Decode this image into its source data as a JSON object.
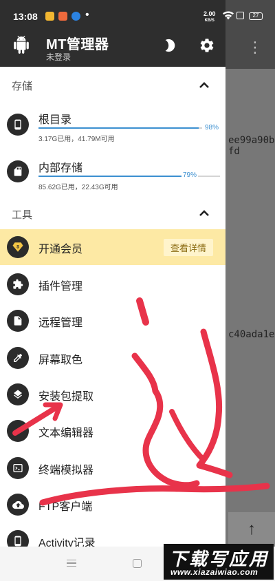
{
  "status_bar": {
    "time": "13:08",
    "dot": "•",
    "net_speed_value": "2.00",
    "net_speed_unit": "KB/S",
    "battery": "27"
  },
  "background": {
    "text_line_1": "ee99a90b",
    "text_line_2": "fd",
    "text_line_3": "c40ada1e",
    "more_glyph": "⋮",
    "up_glyph": "↑"
  },
  "drawer": {
    "app_title": "MT管理器",
    "app_subtitle": "未登录",
    "storage_section": {
      "title": "存储",
      "items": [
        {
          "label": "根目录",
          "info": "3.17G已用，41.79M可用",
          "percent_text": "98%",
          "percent": 98,
          "icon": "phone-icon"
        },
        {
          "label": "内部存储",
          "info": "85.62G已用，22.43G可用",
          "percent_text": "79%",
          "percent": 79,
          "icon": "sd-card-icon"
        }
      ]
    },
    "tools_section": {
      "title": "工具",
      "vip": {
        "label": "开通会员",
        "button": "查看详情",
        "icon": "vip-diamond-icon"
      },
      "items": [
        {
          "label": "插件管理",
          "icon": "puzzle-icon"
        },
        {
          "label": "远程管理",
          "icon": "document-icon"
        },
        {
          "label": "屏幕取色",
          "icon": "eyedropper-icon"
        },
        {
          "label": "安装包提取",
          "icon": "layers-icon"
        },
        {
          "label": "文本编辑器",
          "icon": "edit-icon"
        },
        {
          "label": "终端模拟器",
          "icon": "terminal-icon"
        },
        {
          "label": "FTP客户端",
          "icon": "cloud-ftp-icon"
        },
        {
          "label": "Activity记录",
          "icon": "phone-record-icon"
        }
      ]
    }
  },
  "watermark": {
    "title": "下载写应用",
    "url": "www.xiazaiwiao.com"
  },
  "colors": {
    "header_bg": "#2e2e2e",
    "accent_blue": "#3b8fd0",
    "vip_bg": "#fde9a4",
    "scribble_red": "#e8334a"
  }
}
